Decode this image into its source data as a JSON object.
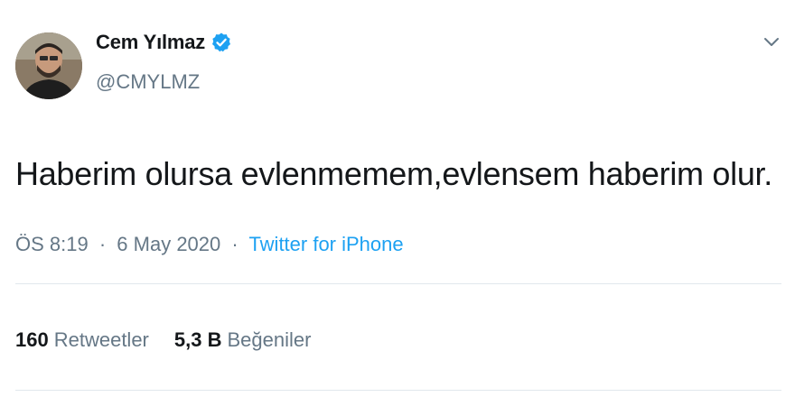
{
  "tweet": {
    "display_name": "Cem Yılmaz",
    "handle": "@CMYLMZ",
    "verified_icon": "verified-badge-icon",
    "menu_icon": "chevron-down-icon",
    "text": "Haberim olursa evlenmemem,evlensem haberim olur.",
    "time": "ÖS 8:19",
    "separator": "·",
    "date": "6 May 2020",
    "source": "Twitter for iPhone",
    "stats": {
      "retweets_count": "160",
      "retweets_label": "Retweetler",
      "likes_count": "5,3 B",
      "likes_label": "Beğeniler"
    }
  },
  "colors": {
    "text": "#14171a",
    "secondary": "#657786",
    "accent": "#1da1f2",
    "divider": "#e1e8ed"
  }
}
